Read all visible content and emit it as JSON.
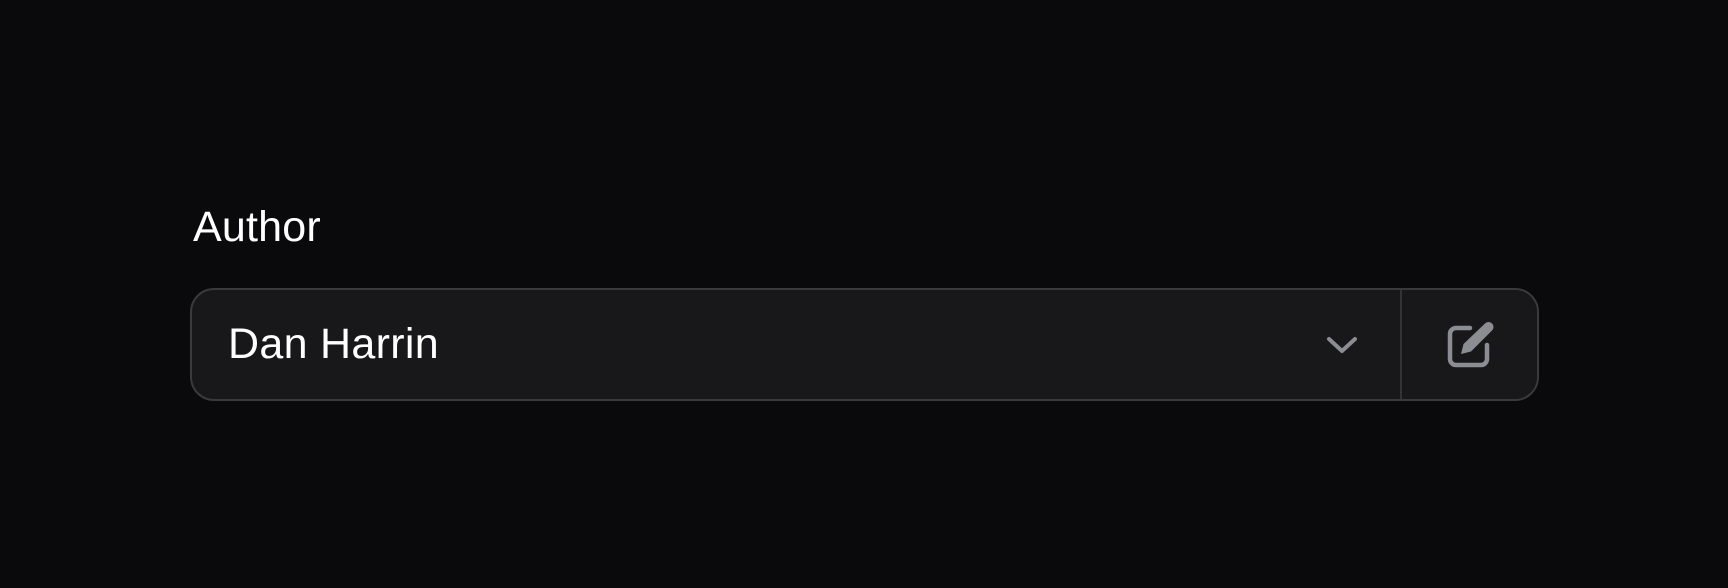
{
  "field": {
    "label": "Author",
    "selected_value": "Dan Harrin"
  },
  "icons": {
    "dropdown": "chevron-down-icon",
    "action": "pencil-square-icon"
  },
  "colors": {
    "background": "#0a0a0c",
    "input_background": "#18181a",
    "border": "#3a3a3d",
    "icon": "#8b8d93",
    "text": "#ffffff"
  }
}
